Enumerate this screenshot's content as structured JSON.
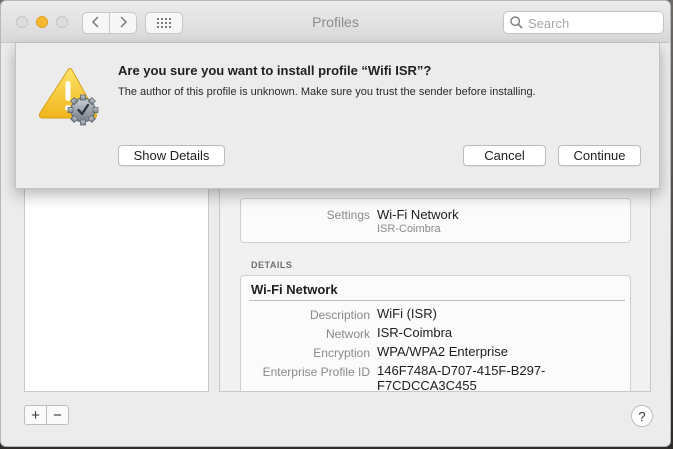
{
  "window": {
    "title": "Profiles",
    "search_placeholder": "Search"
  },
  "sheet": {
    "title": "Are you sure you want to install profile “Wifi ISR”?",
    "message": "The author of this profile is unknown. Make sure you trust the sender before installing.",
    "show_details_label": "Show Details",
    "cancel_label": "Cancel",
    "continue_label": "Continue",
    "icon": "warning-gear-icon"
  },
  "summary": {
    "settings_label": "Settings",
    "settings_value": "Wi-Fi Network",
    "settings_subvalue": "ISR-Coimbra"
  },
  "details": {
    "heading": "DETAILS",
    "section_title": "Wi-Fi Network",
    "rows": [
      {
        "label": "Description",
        "value": "WiFi (ISR)"
      },
      {
        "label": "Network",
        "value": "ISR-Coimbra"
      },
      {
        "label": "Encryption",
        "value": "WPA/WPA2 Enterprise"
      },
      {
        "label": "Enterprise Profile ID",
        "value": "146F748A-D707-415F-B297-",
        "value_cont": "F7CDCCA3C455"
      }
    ]
  },
  "toolbar": {
    "add_label": "+",
    "remove_label": "−",
    "help_label": "?"
  },
  "colors": {
    "traffic_minimize": "#f5b730",
    "warning_yellow": "#f4c52a"
  }
}
